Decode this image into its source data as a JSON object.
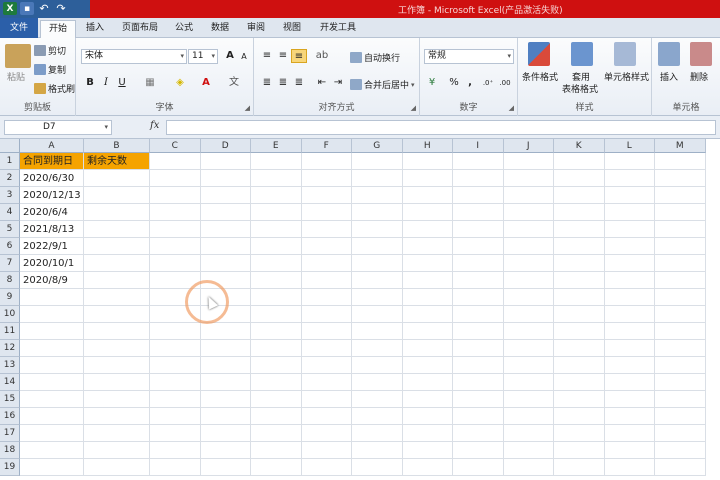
{
  "title_bar": {
    "title": "工作簿 - Microsoft Excel(产品激活失败)"
  },
  "tabs": [
    "文件",
    "开始",
    "插入",
    "页面布局",
    "公式",
    "数据",
    "审阅",
    "视图",
    "开发工具"
  ],
  "clipboard": {
    "paste": "粘贴",
    "cut": "剪切",
    "copy": "复制",
    "painter": "格式刷",
    "label": "剪贴板"
  },
  "font": {
    "name": "宋体",
    "size": "11",
    "grow": "A",
    "shrink": "A",
    "bold": "B",
    "italic": "I",
    "underline": "U",
    "label": "字体"
  },
  "alignment": {
    "wrap": "自动换行",
    "merge": "合并后居中",
    "label": "对齐方式"
  },
  "number": {
    "format": "常规",
    "percent": "%",
    "comma": ",",
    "label": "数字"
  },
  "styles": {
    "conditional": "条件格式",
    "table_line1": "套用",
    "table_line2": "表格格式",
    "cell_styles": "单元格样式",
    "label": "样式"
  },
  "cells": {
    "insert": "插入",
    "delete": "删除",
    "label": "单元格"
  },
  "formula_bar": {
    "name_box": "D7",
    "fx": "fx",
    "value": ""
  },
  "columns": [
    "A",
    "B",
    "C",
    "D",
    "E",
    "F",
    "G",
    "H",
    "I",
    "J",
    "K",
    "L",
    "M"
  ],
  "rows": [
    "1",
    "2",
    "3",
    "4",
    "5",
    "6",
    "7",
    "8",
    "9",
    "10",
    "11",
    "12",
    "13",
    "14",
    "15",
    "16",
    "17",
    "18",
    "19"
  ],
  "cells_data": {
    "A1": "合同到期日",
    "B1": "剩余天数",
    "A2": "2020/6/30",
    "A3": "2020/12/13",
    "A4": "2020/6/4",
    "A5": "2021/8/13",
    "A6": "2022/9/1",
    "A7": "2020/10/1",
    "A8": "2020/8/9"
  },
  "colors": {
    "header_fill": "#f5a300",
    "file_tab": "#2b5fa9",
    "title_bar": "#cf1010"
  }
}
